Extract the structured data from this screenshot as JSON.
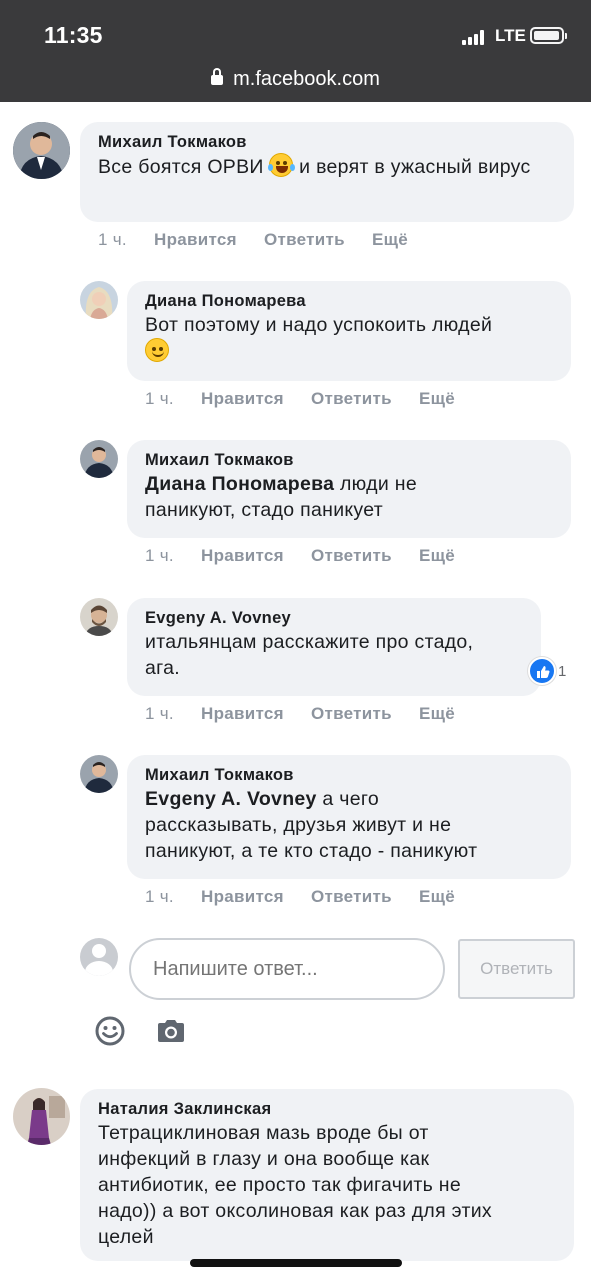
{
  "status_bar": {
    "time": "11:35",
    "network": "LTE"
  },
  "browser": {
    "url": "m.facebook.com"
  },
  "comments": [
    {
      "author": "Михаил Токмаков",
      "text_parts": [
        "Все боятся ОРВИ",
        "и верят в ужасный вирус"
      ],
      "time": "1 ч.",
      "like": "Нравится",
      "reply": "Ответить",
      "more": "Ещё"
    },
    {
      "author": "Диана Пономарева",
      "text": "Вот поэтому и надо успокоить людей",
      "time": "1 ч.",
      "like": "Нравится",
      "reply": "Ответить",
      "more": "Ещё"
    },
    {
      "author": "Михаил Токмаков",
      "mention": "Диана Пономарева",
      "text_line1": "люди не",
      "text_line2": "паникуют, стадо паникует",
      "time": "1 ч.",
      "like": "Нравится",
      "reply": "Ответить",
      "more": "Ещё"
    },
    {
      "author": "Evgeny A. Vovney",
      "text_line1": "итальянцам расскажите про стадо,",
      "text_line2": "ага.",
      "reaction_count": "1",
      "time": "1 ч.",
      "like": "Нравится",
      "reply": "Ответить",
      "more": "Ещё"
    },
    {
      "author": "Михаил Токмаков",
      "mention": "Evgeny A. Vovney",
      "text_line1": "а чего",
      "text_line2": "рассказывать, друзья живут и не",
      "text_line3": "паникуют, а те кто стадо - паникуют",
      "time": "1 ч.",
      "like": "Нравится",
      "reply": "Ответить",
      "more": "Ещё"
    },
    {
      "author": "Наталия Заклинская",
      "text_lines": [
        "Тетрациклиновая мазь вроде бы от",
        "инфекций в глазу и она вообще как",
        "антибиотик, ее просто так фигачить не",
        "надо)) а вот оксолиновая как раз для этих",
        "целей"
      ]
    }
  ],
  "reply_box": {
    "placeholder": "Напишите ответ...",
    "button": "Ответить"
  },
  "icons": [
    "lock-icon",
    "emoji-icon",
    "camera-icon",
    "like-icon"
  ],
  "colors": {
    "bubble": "#f0f2f5",
    "meta": "#8d949e",
    "like_blue": "#1877f2"
  }
}
